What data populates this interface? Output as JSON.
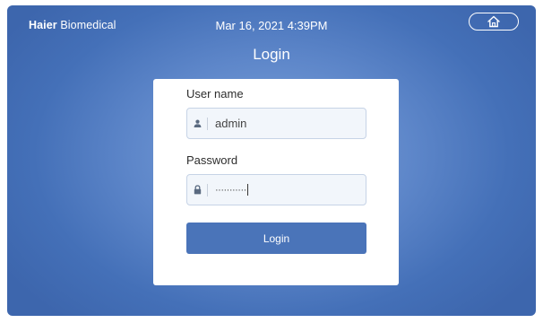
{
  "header": {
    "brand_bold": "Haier",
    "brand_rest": "Biomedical",
    "datetime": "Mar 16, 2021 4:39PM",
    "home_icon": "home-icon"
  },
  "login": {
    "title": "Login",
    "username_label": "User name",
    "username_value": "admin",
    "username_icon": "user-icon",
    "password_label": "Password",
    "password_mask": "···········",
    "password_icon": "lock-icon",
    "button_label": "Login"
  },
  "colors": {
    "background": "#4a74b9",
    "button": "#4a74b9",
    "card": "#ffffff"
  }
}
